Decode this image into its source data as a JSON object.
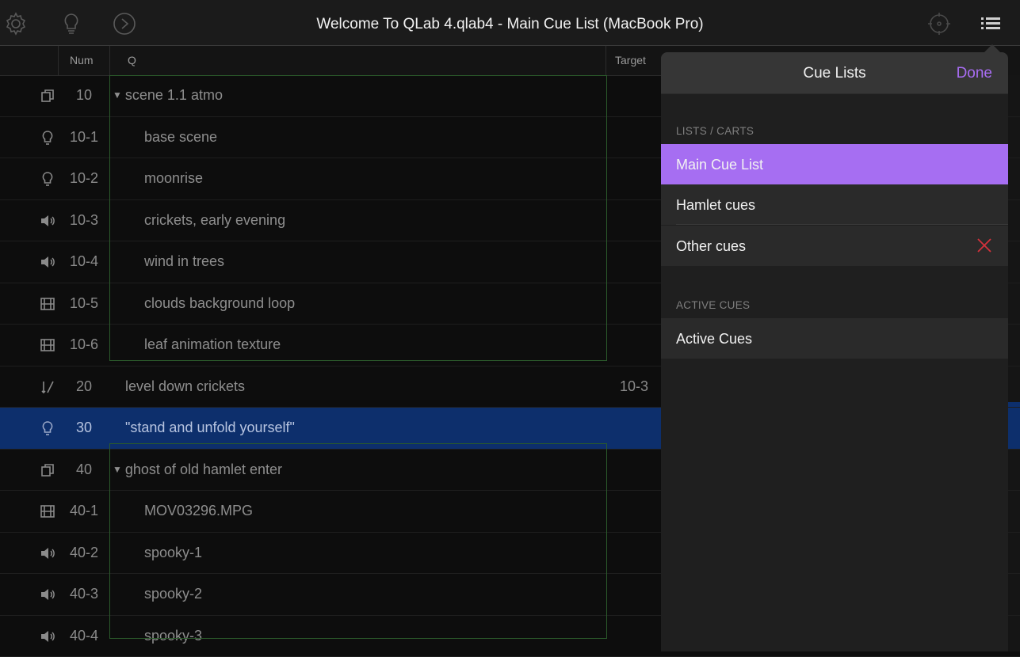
{
  "window": {
    "title": "Welcome To QLab 4.qlab4 - Main Cue List (MacBook Pro)",
    "toolbar_icons": [
      "gear-icon",
      "lightbulb-icon",
      "go-icon",
      "locate-icon",
      "list-icon"
    ]
  },
  "columns": {
    "num": "Num",
    "q": "Q",
    "target": "Target"
  },
  "cues": [
    {
      "type": "group-icon",
      "num": "10",
      "name": "scene 1.1 atmo",
      "group": true,
      "target": ""
    },
    {
      "type": "light-icon",
      "num": "10-1",
      "name": "base scene",
      "child": true,
      "target": ""
    },
    {
      "type": "light-icon",
      "num": "10-2",
      "name": "moonrise",
      "child": true,
      "target": ""
    },
    {
      "type": "audio-icon",
      "num": "10-3",
      "name": "crickets, early evening",
      "child": true,
      "target": ""
    },
    {
      "type": "audio-icon",
      "num": "10-4",
      "name": "wind in trees",
      "child": true,
      "target": ""
    },
    {
      "type": "video-icon",
      "num": "10-5",
      "name": "clouds background loop",
      "child": true,
      "target": ""
    },
    {
      "type": "video-icon",
      "num": "10-6",
      "name": "leaf animation texture",
      "child": true,
      "target": ""
    },
    {
      "type": "fade-icon",
      "num": "20",
      "name": "level down crickets",
      "target": "10-3"
    },
    {
      "type": "light-icon",
      "num": "30",
      "name": "\"stand and unfold yourself\"",
      "selected": true,
      "target": ""
    },
    {
      "type": "group-icon",
      "num": "40",
      "name": "ghost of old hamlet enter",
      "group": true,
      "target": ""
    },
    {
      "type": "video-icon",
      "num": "40-1",
      "name": "MOV03296.MPG",
      "child": true,
      "target": ""
    },
    {
      "type": "audio-icon",
      "num": "40-2",
      "name": "spooky-1",
      "child": true,
      "target": ""
    },
    {
      "type": "audio-icon",
      "num": "40-3",
      "name": "spooky-2",
      "child": true,
      "target": ""
    },
    {
      "type": "audio-icon",
      "num": "40-4",
      "name": "spooky-3",
      "child": true,
      "target": ""
    }
  ],
  "popover": {
    "title": "Cue Lists",
    "done_label": "Done",
    "section_lists": "LISTS / CARTS",
    "lists": [
      {
        "label": "Main Cue List",
        "active": true
      },
      {
        "label": "Hamlet cues",
        "active": false
      },
      {
        "label": "Other cues",
        "active": false,
        "deletable": true
      }
    ],
    "section_active": "ACTIVE CUES",
    "active_item": "Active Cues"
  },
  "colors": {
    "accent": "#a66ef2",
    "selection": "#0d2f6c",
    "group_border": "#2b5a2b",
    "delete": "#d4313b"
  }
}
